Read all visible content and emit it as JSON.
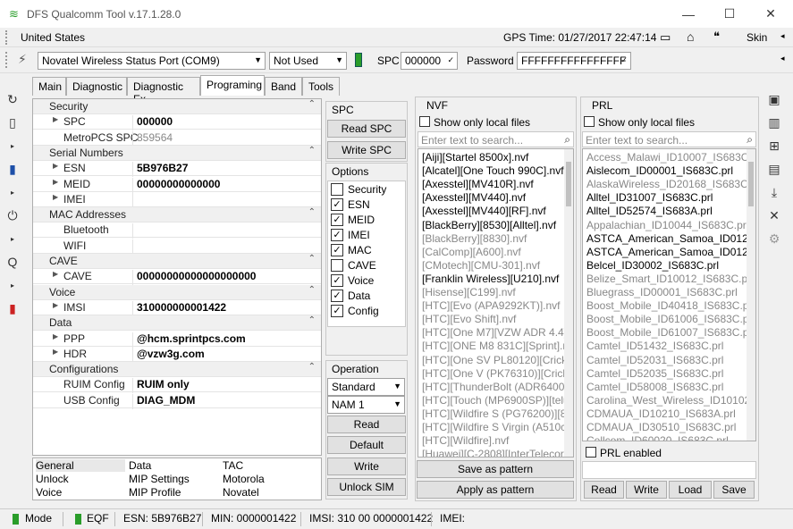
{
  "window": {
    "title": "DFS Qualcomm Tool v.17.1.28.0"
  },
  "menubar": {
    "country": "United States",
    "gps_time": "GPS Time: 01/27/2017 22:47:14",
    "skin": "Skin"
  },
  "toolbar": {
    "port": "Novatel Wireless Status Port (COM9)",
    "not_used": "Not Used",
    "spc_label": "SPC",
    "spc_value": "000000",
    "password_label": "Password",
    "password_value": "FFFFFFFFFFFFFFFF"
  },
  "tabs": [
    "Main",
    "Diagnostic",
    "Diagnostic Ex",
    "Programing",
    "Band",
    "Tools"
  ],
  "properties": [
    {
      "type": "cat",
      "label": "Security"
    },
    {
      "type": "row",
      "label": "SPC",
      "value": "000000",
      "exp": true
    },
    {
      "type": "row",
      "label": "MetroPCS SPC",
      "value": "859564",
      "dim": true
    },
    {
      "type": "cat",
      "label": "Serial Numbers"
    },
    {
      "type": "row",
      "label": "ESN",
      "value": "5B976B27",
      "exp": true
    },
    {
      "type": "row",
      "label": "MEID",
      "value": "00000000000000",
      "exp": true
    },
    {
      "type": "row",
      "label": "IMEI",
      "value": "",
      "exp": true
    },
    {
      "type": "cat",
      "label": "MAC Addresses"
    },
    {
      "type": "row",
      "label": "Bluetooth",
      "value": ""
    },
    {
      "type": "row",
      "label": "WIFI",
      "value": ""
    },
    {
      "type": "cat",
      "label": "CAVE"
    },
    {
      "type": "row",
      "label": "CAVE",
      "value": "00000000000000000000",
      "exp": true
    },
    {
      "type": "cat",
      "label": "Voice"
    },
    {
      "type": "row",
      "label": "IMSI",
      "value": "310000000001422",
      "exp": true
    },
    {
      "type": "cat",
      "label": "Data"
    },
    {
      "type": "row",
      "label": "PPP",
      "value": "@hcm.sprintpcs.com",
      "exp": true
    },
    {
      "type": "row",
      "label": "HDR",
      "value": "@vzw3g.com",
      "exp": true
    },
    {
      "type": "cat",
      "label": "Configurations"
    },
    {
      "type": "row",
      "label": "RUIM Config",
      "value": "RUIM only"
    },
    {
      "type": "row",
      "label": "USB Config",
      "value": "DIAG_MDM"
    }
  ],
  "bottom_grid": [
    [
      "General",
      "Data",
      "TAC"
    ],
    [
      "Unlock",
      "MIP Settings",
      "Motorola"
    ],
    [
      "Voice",
      "MIP Profile",
      "Novatel"
    ]
  ],
  "spc_group": {
    "title": "SPC",
    "read": "Read SPC",
    "write": "Write SPC"
  },
  "options_group": {
    "title": "Options",
    "items": [
      {
        "label": "Security",
        "checked": false
      },
      {
        "label": "ESN",
        "checked": true
      },
      {
        "label": "MEID",
        "checked": true
      },
      {
        "label": "IMEI",
        "checked": true
      },
      {
        "label": "MAC",
        "checked": true
      },
      {
        "label": "CAVE",
        "checked": false
      },
      {
        "label": "Voice",
        "checked": true
      },
      {
        "label": "Data",
        "checked": true
      },
      {
        "label": "Config",
        "checked": true
      }
    ]
  },
  "operation_group": {
    "title": "Operation",
    "mode": "Standard",
    "nam": "NAM 1",
    "read": "Read",
    "default": "Default",
    "write": "Write",
    "unlock": "Unlock SIM"
  },
  "nvf": {
    "title": "NVF",
    "show_local": "Show only local files",
    "search_placeholder": "Enter text to search...",
    "items": [
      {
        "t": "[Aiji][Startel 8500x].nvf",
        "d": false
      },
      {
        "t": "[Alcatel][One Touch 990C].nvf",
        "d": false
      },
      {
        "t": "[Axesstel][MV410R].nvf",
        "d": false
      },
      {
        "t": "[Axesstel][MV440].nvf",
        "d": false
      },
      {
        "t": "[Axesstel][MV440][RF].nvf",
        "d": false
      },
      {
        "t": "[BlackBerry][8530][Alltel].nvf",
        "d": false
      },
      {
        "t": "[BlackBerry][8830].nvf",
        "d": true
      },
      {
        "t": "[CalComp][A600].nvf",
        "d": true
      },
      {
        "t": "[CMotech][CMU-301].nvf",
        "d": true
      },
      {
        "t": "[Franklin Wireless][U210].nvf",
        "d": false
      },
      {
        "t": "[Hisense][C199].nvf",
        "d": true
      },
      {
        "t": "[HTC][Evo (APA9292KT)].nvf",
        "d": true
      },
      {
        "t": "[HTC][Evo Shift].nvf",
        "d": true
      },
      {
        "t": "[HTC][One M7][VZW ADR 4.4]",
        "d": true
      },
      {
        "t": "[HTC][ONE M8 831C][Sprint].n",
        "d": true
      },
      {
        "t": "[HTC][One SV PL80120][Cricke",
        "d": true
      },
      {
        "t": "[HTC][One V (PK76310)][Cricke",
        "d": true
      },
      {
        "t": "[HTC][ThunderBolt (ADR6400)]",
        "d": true
      },
      {
        "t": "[HTC][Touch (MP6900SP)][telu",
        "d": true
      },
      {
        "t": "[HTC][Wildfire S (PG76200)][80",
        "d": true
      },
      {
        "t": "[HTC][Wildfire S Virgin (A510c)]",
        "d": true
      },
      {
        "t": "[HTC][Wildfire].nvf",
        "d": true
      },
      {
        "t": "[Huawei][C-2808][InterTelecor",
        "d": true
      }
    ],
    "save": "Save as pattern",
    "apply": "Apply as pattern"
  },
  "prl": {
    "title": "PRL",
    "show_local": "Show only local files",
    "search_placeholder": "Enter text to search...",
    "items": [
      {
        "t": "Access_Malawi_ID10007_IS683C.p",
        "d": true
      },
      {
        "t": "Aislecom_ID00001_IS683C.prl",
        "d": false
      },
      {
        "t": "AlaskaWireless_ID20168_IS683C.p",
        "d": true
      },
      {
        "t": "Alltel_ID31007_IS683C.prl",
        "d": false
      },
      {
        "t": "Alltel_ID52574_IS683A.prl",
        "d": false
      },
      {
        "t": "Appalachian_ID10044_IS683C.prl",
        "d": true
      },
      {
        "t": "ASTCA_American_Samoa_ID01234",
        "d": false
      },
      {
        "t": "ASTCA_American_Samoa_ID01234",
        "d": false
      },
      {
        "t": "Belcel_ID30002_IS683C.prl",
        "d": false
      },
      {
        "t": "Belize_Smart_ID10012_IS683C.prl",
        "d": true
      },
      {
        "t": "Bluegrass_ID00001_IS683C.prl",
        "d": true
      },
      {
        "t": "Boost_Mobile_ID40418_IS683C.prl",
        "d": true
      },
      {
        "t": "Boost_Mobile_ID61006_IS683C.prl",
        "d": true
      },
      {
        "t": "Boost_Mobile_ID61007_IS683C.prl",
        "d": true
      },
      {
        "t": "Camtel_ID51432_IS683C.prl",
        "d": true
      },
      {
        "t": "Camtel_ID52031_IS683C.prl",
        "d": true
      },
      {
        "t": "Camtel_ID52035_IS683C.prl",
        "d": true
      },
      {
        "t": "Camtel_ID58008_IS683C.prl",
        "d": true
      },
      {
        "t": "Carolina_West_Wireless_ID10102_",
        "d": true
      },
      {
        "t": "CDMAUA_ID10210_IS683A.prl",
        "d": true
      },
      {
        "t": "CDMAUA_ID30510_IS683C.prl",
        "d": true
      },
      {
        "t": "Cellcom_ID60020_IS683C.prl",
        "d": true
      }
    ],
    "prl_enabled": "PRL enabled",
    "read": "Read",
    "write": "Write",
    "load": "Load",
    "save": "Save"
  },
  "status": {
    "mode": "Mode",
    "eqf": "EQF",
    "esn": "ESN: 5B976B27",
    "min": "MIN: 0000001422",
    "imsi": "IMSI: 310 00 0000001422",
    "imei": "IMEI:"
  }
}
